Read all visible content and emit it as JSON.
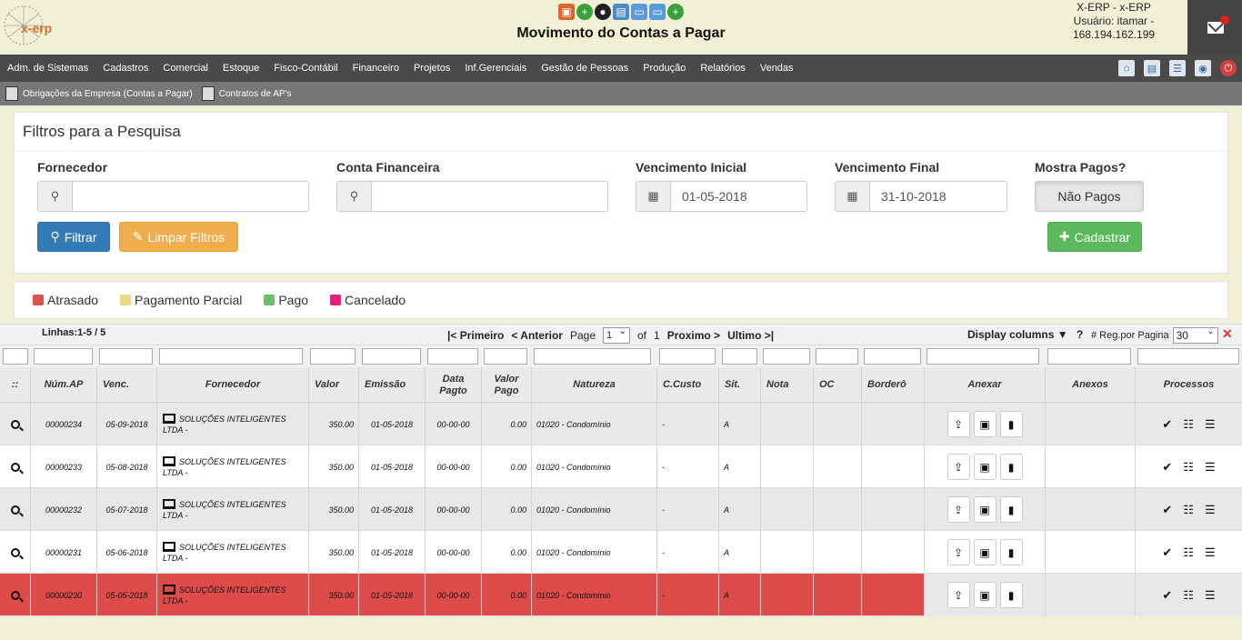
{
  "header": {
    "logo_text": "x-erp",
    "title": "Movimento do Contas a Pagar",
    "user_line1": "X-ERP - x-ERP",
    "user_line2": "Usuário: itamar -",
    "user_line3": "168.194.162.199"
  },
  "menu": {
    "items": [
      "Adm. de Sistemas",
      "Cadastros",
      "Comercial",
      "Estoque",
      "Fisco-Contábil",
      "Financeiro",
      "Projetos",
      "Inf.Gerenciais",
      "Gestão de Pessoas",
      "Produção",
      "Relatórios",
      "Vendas"
    ]
  },
  "submenu": {
    "item1": "Obrigações da Empresa (Contas a Pagar)",
    "item2": "Contratos de AP's"
  },
  "filters": {
    "title": "Filtros para a Pesquisa",
    "fornecedor_label": "Fornecedor",
    "fornecedor_value": "",
    "conta_label": "Conta Financeira",
    "conta_value": "",
    "venc_ini_label": "Vencimento Inicial",
    "venc_ini_value": "01-05-2018",
    "venc_fim_label": "Vencimento Final",
    "venc_fim_value": "31-10-2018",
    "mostra_label": "Mostra Pagos?",
    "mostra_value": "Não Pagos",
    "btn_filtrar": "Filtrar",
    "btn_limpar": "Limpar Filtros",
    "btn_cadastrar": "Cadastrar"
  },
  "legend": {
    "atrasado": "Atrasado",
    "parcial": "Pagamento Parcial",
    "pago": "Pago",
    "cancelado": "Cancelado",
    "colors": {
      "atrasado": "#d9534f",
      "parcial": "#e8d984",
      "pago": "#6dbb6d",
      "cancelado": "#e91e7a"
    }
  },
  "pager": {
    "lines": "Linhas:1-5 / 5",
    "first": "|< Primeiro",
    "prev": "< Anterior",
    "page_label": "Page",
    "page_value": "1",
    "of_label": "of",
    "total_pages": "1",
    "next": "Proximo >",
    "last": "Ultimo >|",
    "display_columns": "Display columns ▼",
    "help": "?",
    "rpp_label": "# Reg.por Pagina",
    "rpp_value": "30",
    "clear": "✕"
  },
  "columns": {
    "sel": "::",
    "num": "Núm.AP",
    "venc": "Venc.",
    "forn": "Fornecedor",
    "valor": "Valor",
    "emissao": "Emissão",
    "dpag_1": "Data",
    "dpag_2": "Pagto",
    "vpag_1": "Valor",
    "vpag_2": "Pago",
    "natureza": "Natureza",
    "ccusto": "C.Custo",
    "sit": "Sit.",
    "nota": "Nota",
    "oc": "OC",
    "bordero": "Borderô",
    "anexar": "Anexar",
    "anexos": "Anexos",
    "processos": "Processos"
  },
  "rows": [
    {
      "num": "00000234",
      "venc": "05-09-2018",
      "forn1": "SOLUÇÕES INTELIGENTES",
      "forn2": "LTDA -",
      "valor": "350.00",
      "emissao": "01-05-2018",
      "dpag": "00-00-00",
      "vpag": "0.00",
      "natureza": "01020 - Condomínio",
      "ccusto": "-",
      "sit": "A",
      "nota": "",
      "oc": "",
      "bordero": "",
      "anexos": ""
    },
    {
      "num": "00000233",
      "venc": "05-08-2018",
      "forn1": "SOLUÇÕES INTELIGENTES",
      "forn2": "LTDA -",
      "valor": "350.00",
      "emissao": "01-05-2018",
      "dpag": "00-00-00",
      "vpag": "0.00",
      "natureza": "01020 - Condomínio",
      "ccusto": "-",
      "sit": "A",
      "nota": "",
      "oc": "",
      "bordero": "",
      "anexos": ""
    },
    {
      "num": "00000232",
      "venc": "05-07-2018",
      "forn1": "SOLUÇÕES INTELIGENTES",
      "forn2": "LTDA -",
      "valor": "350.00",
      "emissao": "01-05-2018",
      "dpag": "00-00-00",
      "vpag": "0.00",
      "natureza": "01020 - Condomínio",
      "ccusto": "-",
      "sit": "A",
      "nota": "",
      "oc": "",
      "bordero": "",
      "anexos": ""
    },
    {
      "num": "00000231",
      "venc": "05-06-2018",
      "forn1": "SOLUÇÕES INTELIGENTES",
      "forn2": "LTDA -",
      "valor": "350.00",
      "emissao": "01-05-2018",
      "dpag": "00-00-00",
      "vpag": "0.00",
      "natureza": "01020 - Condomínio",
      "ccusto": "-",
      "sit": "A",
      "nota": "",
      "oc": "",
      "bordero": "",
      "anexos": ""
    },
    {
      "num": "00000230",
      "venc": "05-05-2018",
      "forn1": "SOLUÇÕES INTELIGENTES",
      "forn2": "LTDA -",
      "valor": "350.00",
      "emissao": "01-05-2018",
      "dpag": "00-00-00",
      "vpag": "0.00",
      "natureza": "01020 - Condomínio",
      "ccusto": "-",
      "sit": "A",
      "nota": "",
      "oc": "",
      "bordero": "",
      "anexos": ""
    }
  ],
  "row_status": [
    "normal",
    "normal",
    "normal",
    "normal",
    "atrasado"
  ],
  "icons": {
    "search": "search-icon",
    "monitor": "monitor-icon",
    "upload": "upload-icon",
    "money": "money-icon",
    "file": "file-icon",
    "check": "check-icon",
    "list": "list-icon",
    "menu": "menu-icon"
  }
}
